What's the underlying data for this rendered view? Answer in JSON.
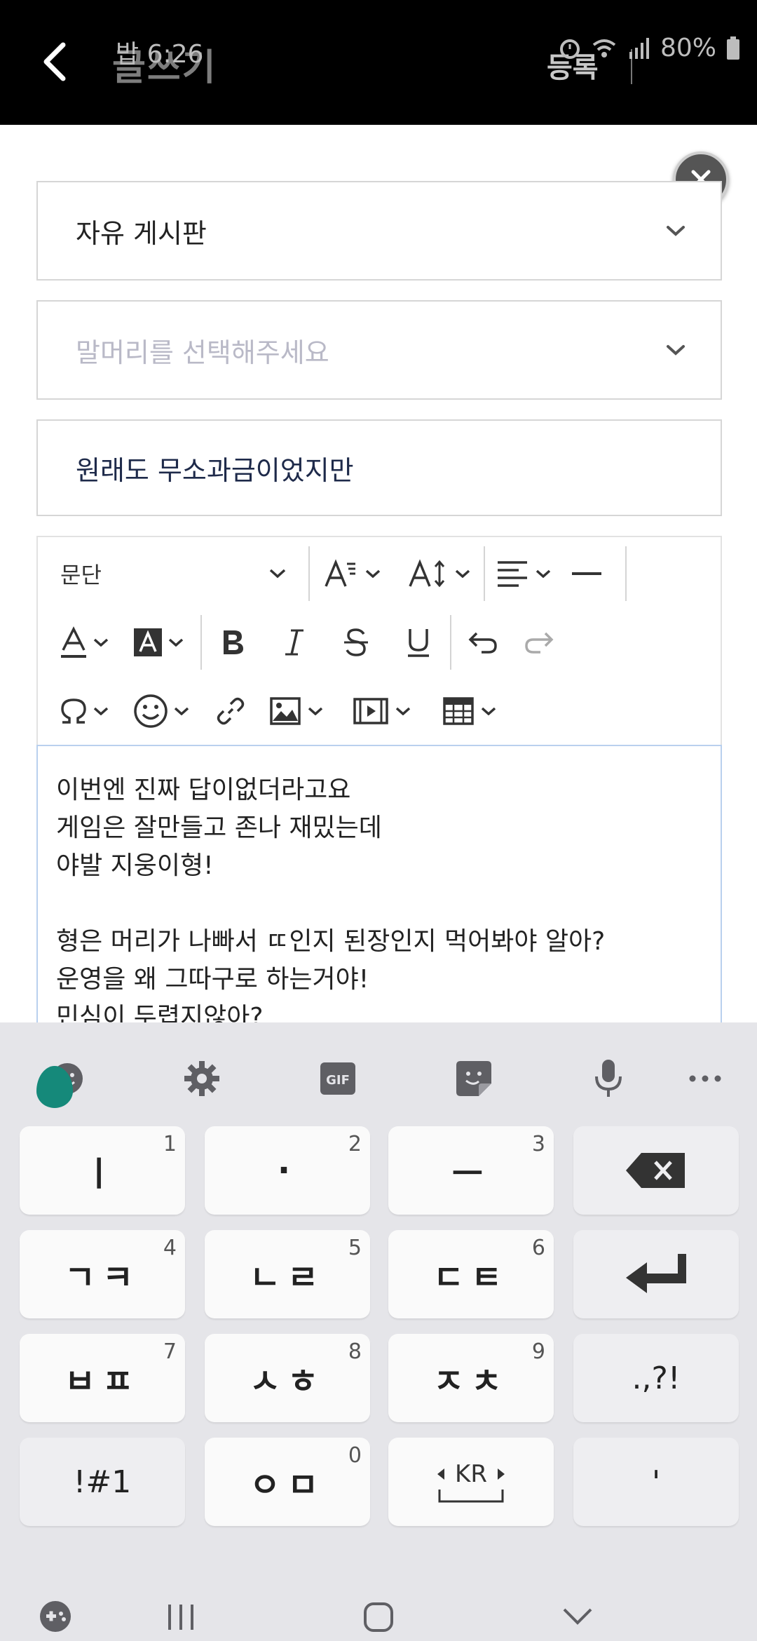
{
  "header": {
    "title": "글쓰기",
    "status_time": "밥 6:26",
    "battery": "80%",
    "register_label": "등록"
  },
  "fields": {
    "board": "자유 게시판",
    "prefix_placeholder": "말머리를 선택해주세요",
    "title_value": "원래도 무소과금이었지만"
  },
  "toolbar": {
    "paragraph": "문단"
  },
  "editor": {
    "lines": [
      "이번엔 진짜 답이없더라고요",
      "게임은 잘만들고 존나 재밌는데",
      "야발 지웅이형!",
      "",
      "형은 머리가 나빠서 ㄸ인지 된장인지 먹어봐야 알아?",
      "운영을 왜 그따구로 하는거야!",
      "민심이 두렵지않아?"
    ]
  },
  "keyboard": {
    "keys": [
      {
        "label": "ㅣ",
        "num": "1"
      },
      {
        "label": "·",
        "num": "2"
      },
      {
        "label": "ㅡ",
        "num": "3"
      },
      {
        "label": "ㄱㅋ",
        "num": "4"
      },
      {
        "label": "ㄴㄹ",
        "num": "5"
      },
      {
        "label": "ㄷㅌ",
        "num": "6"
      },
      {
        "label": "ㅂㅍ",
        "num": "7"
      },
      {
        "label": "ㅅㅎ",
        "num": "8"
      },
      {
        "label": "ㅈㅊ",
        "num": "9"
      },
      {
        "label": "ㅇㅁ",
        "num": "0"
      }
    ],
    "punct": ".,?!",
    "symbols": "!#1",
    "lang": "KR",
    "apostrophe": "'",
    "toolbar_gif": "GIF"
  },
  "colors": {
    "header_bg": "#000000",
    "accent_green": "#15897a",
    "keyboard_bg": "#e5e5e9"
  }
}
